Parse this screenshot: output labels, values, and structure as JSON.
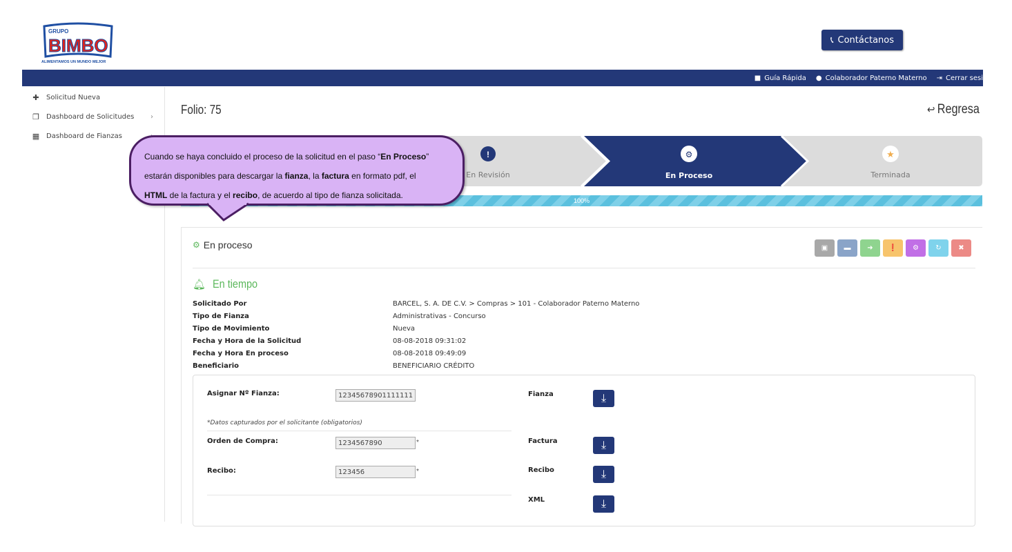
{
  "header": {
    "logo_top": "GRUPO",
    "logo_brand": "BIMBO",
    "logo_tagline": "ALIMENTAMOS UN MUNDO MEJOR",
    "contact_label": "Contáctanos",
    "links": [
      {
        "icon": "book-icon",
        "label": "Guía Rápida"
      },
      {
        "icon": "user-icon",
        "label": "Colaborador Paterno Materno"
      },
      {
        "icon": "sign-out-icon",
        "label": "Cerrar sesi"
      }
    ]
  },
  "sidebar": {
    "items": [
      {
        "icon": "plus-icon",
        "label": "Solicitud Nueva"
      },
      {
        "icon": "copy-icon",
        "label": "Dashboard de Solicitudes"
      },
      {
        "icon": "table-icon",
        "label": "Dashboard de Fianzas"
      }
    ]
  },
  "main": {
    "folio": "Folio: 75",
    "back_label": "Regresa",
    "steps": [
      {
        "label": "En Revisión",
        "icon": "exclamation-icon",
        "state": "done"
      },
      {
        "label": "En Proceso",
        "icon": "gears-icon",
        "state": "active"
      },
      {
        "label": "Terminada",
        "icon": "star-icon",
        "state": "pending"
      }
    ],
    "progress": 1.0,
    "progress_label": "100%"
  },
  "panel": {
    "title": "En proceso",
    "status": "En tiempo",
    "actions": [
      {
        "icon": "pdf-icon",
        "color": "#a8a8a8"
      },
      {
        "icon": "comment-icon",
        "color": "#8aa4c8"
      },
      {
        "icon": "arrow-right-icon",
        "color": "#8fd48f"
      },
      {
        "icon": "exclamation-circle-icon",
        "color": "#f7c46c"
      },
      {
        "icon": "gears-icon",
        "color": "#c16fe6"
      },
      {
        "icon": "refresh-icon",
        "color": "#7fd3ec"
      },
      {
        "icon": "close-icon",
        "color": "#ec8a86"
      }
    ],
    "info": [
      {
        "k": "Solicitado Por",
        "v": "BARCEL, S. A. DE C.V.  >  Compras  >  101  -  Colaborador Paterno Materno"
      },
      {
        "k": "Tipo de Fianza",
        "v": "Administrativas - Concurso"
      },
      {
        "k": "Tipo de Movimiento",
        "v": "Nueva"
      },
      {
        "k": "Fecha y Hora de la Solicitud",
        "v": "08-08-2018 09:31:02"
      },
      {
        "k": "Fecha y Hora En proceso",
        "v": "08-08-2018 09:49:09"
      },
      {
        "k": "Beneficiario",
        "v": "BENEFICIARIO CRÉDITO"
      }
    ],
    "form": {
      "fianza_label": "Asignar Nº Fianza:",
      "fianza_value": "12345678901111111",
      "note": "*Datos capturados por el solicitante (obligatorios)",
      "orden_label": "Orden de Compra:",
      "orden_value": "1234567890",
      "recibo_label": "Recibo:",
      "recibo_value": "123456",
      "required_mark": "*"
    },
    "downloads": [
      "Fianza",
      "Factura",
      "Recibo",
      "XML"
    ]
  },
  "callout": {
    "l1a": "Cuando se haya concluido el proceso de la solicitud en el paso “",
    "l1b": "En Proceso",
    "l1c": "”",
    "l2a": "estarán disponibles para descargar la ",
    "l2b": "fianza",
    "l2c": ", la ",
    "l2d": "factura",
    "l2e": " en formato pdf,  el",
    "l3a": "HTML",
    "l3b": " de la factura y el ",
    "l3c": "recibo",
    "l3d": ", de acuerdo al tipo de fianza solicitada."
  }
}
